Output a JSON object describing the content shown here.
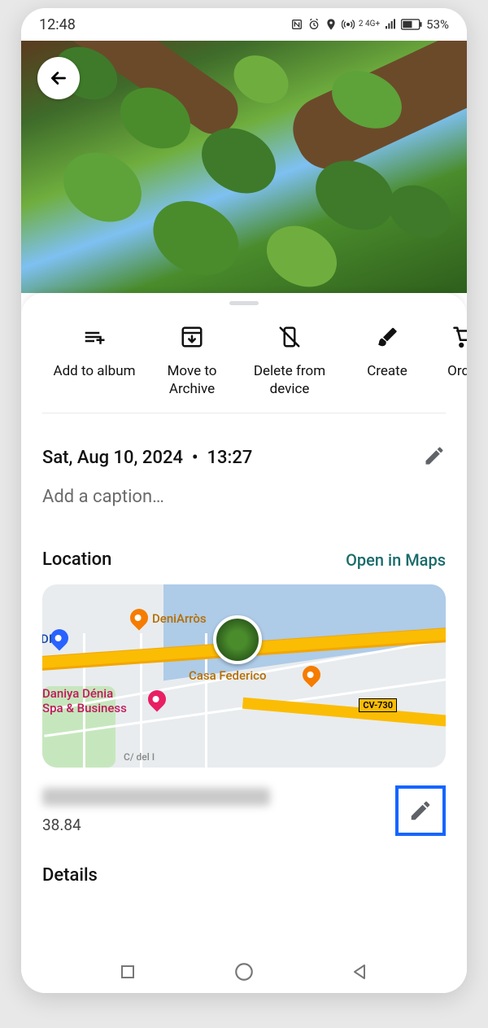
{
  "status": {
    "time": "12:48",
    "battery": "53%",
    "net": "4G+"
  },
  "actions": [
    {
      "name": "add-to-album",
      "label": "Add to album"
    },
    {
      "name": "move-to-archive",
      "label": "Move to Archive"
    },
    {
      "name": "delete-from-device",
      "label": "Delete from device"
    },
    {
      "name": "create",
      "label": "Create"
    },
    {
      "name": "order",
      "label": "Order"
    }
  ],
  "datetime": {
    "date": "Sat, Aug 10, 2024",
    "sep": "•",
    "time": "13:27"
  },
  "caption_placeholder": "Add a caption…",
  "location": {
    "heading": "Location",
    "open_link": "Open in Maps",
    "places": {
      "deniarros": "DeniArròs",
      "casa": "Casa Federico",
      "hotel": "Daniya Dénia\nSpa & Business",
      "aldi": "ALDI",
      "road_tag": "CV-730",
      "street": "C/ del I"
    },
    "coord": "38.84"
  },
  "details_heading": "Details"
}
